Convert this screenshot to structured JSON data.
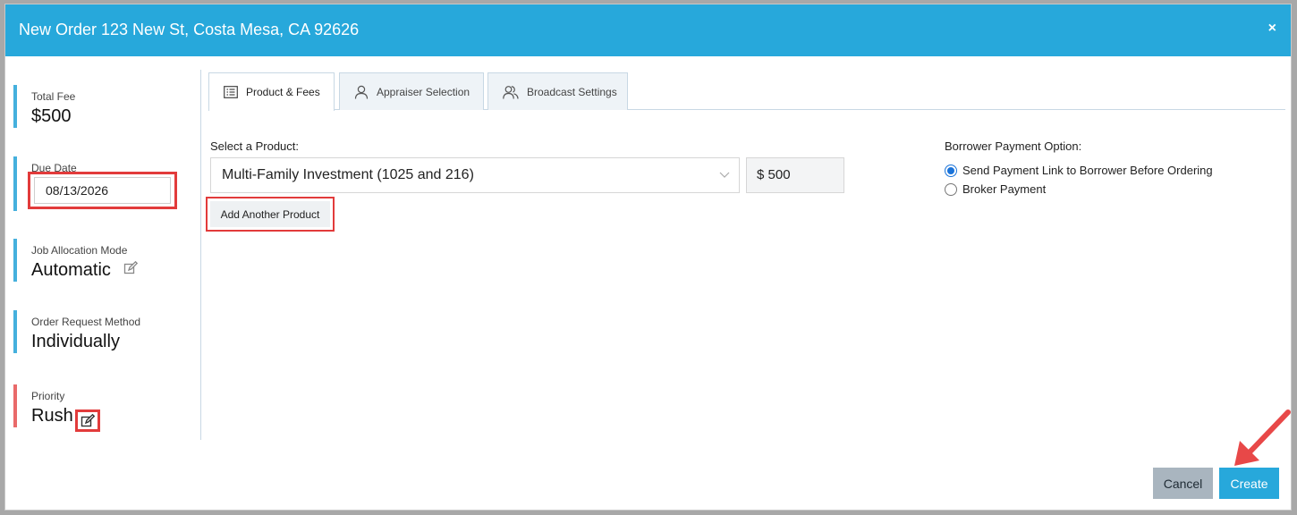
{
  "header": {
    "title": "New Order 123 New St, Costa Mesa, CA 92626",
    "close_label": "×"
  },
  "sidebar": {
    "total_fee": {
      "label": "Total Fee",
      "value": "$500"
    },
    "due_date": {
      "label": "Due Date",
      "value": "08/13/2026"
    },
    "job_allocation": {
      "label": "Job Allocation Mode",
      "value": "Automatic",
      "icon": "edit-icon"
    },
    "order_request": {
      "label": "Order Request Method",
      "value": "Individually"
    },
    "priority": {
      "label": "Priority",
      "value": "Rush",
      "icon": "edit-icon"
    }
  },
  "tabs": [
    {
      "label": "Product & Fees",
      "icon": "list-icon",
      "active": true
    },
    {
      "label": "Appraiser Selection",
      "icon": "person-icon",
      "active": false
    },
    {
      "label": "Broadcast Settings",
      "icon": "people-icon",
      "active": false
    }
  ],
  "product": {
    "select_label": "Select a Product:",
    "selected": "Multi-Family Investment (1025 and 216)",
    "price": "$ 500",
    "add_button": "Add Another Product"
  },
  "borrower_payment": {
    "title": "Borrower Payment Option:",
    "options": [
      {
        "label": "Send Payment Link to Borrower Before Ordering",
        "checked": true
      },
      {
        "label": "Broker Payment",
        "checked": false
      }
    ]
  },
  "footer": {
    "cancel": "Cancel",
    "create": "Create"
  },
  "colors": {
    "header": "#27a8db",
    "accent_blue": "#45b0dd",
    "priority_red": "#e96a6a",
    "highlight_red": "#e23b3b",
    "cancel_gray": "#a9b5bf"
  }
}
